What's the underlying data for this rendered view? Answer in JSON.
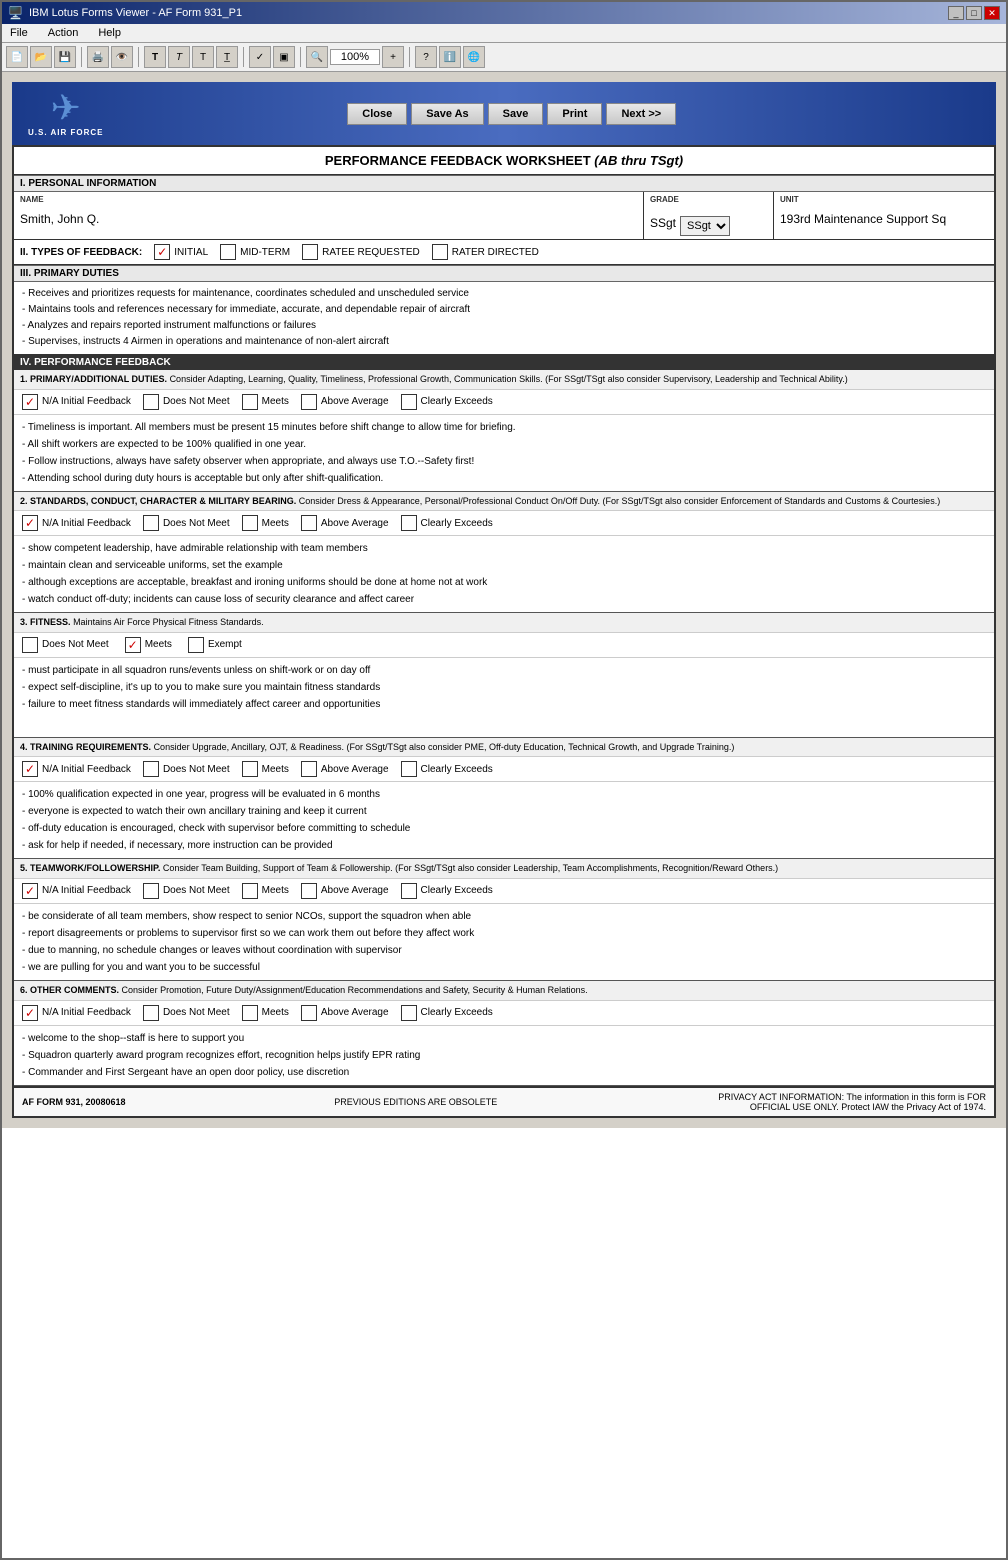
{
  "window": {
    "title": "IBM Lotus Forms Viewer - AF Form 931_P1",
    "titlebar_icon": "🪟"
  },
  "menu": {
    "items": [
      "File",
      "Action",
      "Help"
    ]
  },
  "toolbar": {
    "zoom": "100%"
  },
  "header": {
    "logo_text": "U.S. AIR FORCE",
    "buttons": [
      "Close",
      "Save As",
      "Save",
      "Print",
      "Next >>"
    ]
  },
  "form": {
    "title": "PERFORMANCE FEEDBACK WORKSHEET",
    "title_subtitle": "(AB thru TSgt)",
    "sections": {
      "personal_info_header": "I.  PERSONAL INFORMATION",
      "name_label": "NAME",
      "name_value": "Smith, John Q.",
      "grade_label": "GRADE",
      "grade_value": "SSgt",
      "unit_label": "UNIT",
      "unit_value": "193rd Maintenance Support Sq",
      "feedback_types_label": "II.  TYPES OF FEEDBACK:",
      "feedback_types": [
        {
          "label": "INITIAL",
          "checked": true
        },
        {
          "label": "MID-TERM",
          "checked": false
        },
        {
          "label": "RATEE REQUESTED",
          "checked": false
        },
        {
          "label": "RATER DIRECTED",
          "checked": false
        }
      ],
      "primary_duties_header": "III.  PRIMARY DUTIES",
      "primary_duties": [
        "- Receives and prioritizes requests for maintenance, coordinates scheduled and unscheduled service",
        "- Maintains tools and references necessary for immediate, accurate, and dependable repair of aircraft",
        "- Analyzes and repairs reported instrument malfunctions or failures",
        "- Supervises, instructs 4 Airmen in operations and maintenance of non-alert aircraft"
      ],
      "perf_feedback_header": "IV.  PERFORMANCE FEEDBACK",
      "perf_items": [
        {
          "number": "1.",
          "title": "PRIMARY/ADDITIONAL DUTIES.",
          "description": "Consider Adapting, Learning, Quality, Timeliness, Professional Growth, Communication Skills.  (For SSgt/TSgt also consider Supervisory, Leadership and Technical Ability.)",
          "ratings": [
            "N/A Initial Feedback",
            "Does Not Meet",
            "Meets",
            "Above Average",
            "Clearly Exceeds"
          ],
          "checked": "N/A Initial Feedback",
          "text": [
            "- Timeliness is important.  All members must be present 15 minutes before shift change to allow time for briefing.",
            "- All shift workers are expected to be 100% qualified in one year.",
            "- Follow instructions, always have safety observer when appropriate, and always use T.O.--Safety first!",
            "- Attending school during duty hours is acceptable but only after shift-qualification."
          ]
        },
        {
          "number": "2.",
          "title": "STANDARDS, CONDUCT, CHARACTER & MILITARY BEARING.",
          "description": "Consider Dress & Appearance, Personal/Professional Conduct On/Off Duty.  (For SSgt/TSgt also consider Enforcement of Standards and Customs & Courtesies.)",
          "ratings": [
            "N/A Initial Feedback",
            "Does Not Meet",
            "Meets",
            "Above Average",
            "Clearly Exceeds"
          ],
          "checked": "N/A Initial Feedback",
          "text": [
            "- show competent leadership, have admirable relationship with team members",
            "- maintain clean and serviceable uniforms, set the example",
            "- although exceptions are acceptable, breakfast and ironing uniforms should be done at home not at work",
            "- watch conduct off-duty; incidents can cause loss of security clearance and affect career"
          ]
        },
        {
          "number": "3.",
          "title": "FITNESS.",
          "description": "Maintains Air Force Physical Fitness Standards.",
          "ratings": [
            "Does Not Meet",
            "Meets",
            "Exempt"
          ],
          "checked": "Meets",
          "fitness": true,
          "text": [
            "- must participate in all squadron runs/events unless on shift-work or on day off",
            "- expect self-discipline, it's up to you to make sure you maintain fitness standards",
            "- failure to meet fitness standards will immediately affect career and opportunities"
          ]
        },
        {
          "number": "4.",
          "title": "TRAINING REQUIREMENTS.",
          "description": "Consider Upgrade, Ancillary, OJT, & Readiness.  (For SSgt/TSgt also consider PME, Off-duty Education, Technical Growth, and Upgrade Training.)",
          "ratings": [
            "N/A Initial Feedback",
            "Does Not Meet",
            "Meets",
            "Above Average",
            "Clearly Exceeds"
          ],
          "checked": "N/A Initial Feedback",
          "text": [
            "- 100% qualification expected in one year, progress will be evaluated in 6 months",
            "- everyone is expected to watch their own ancillary training and keep it current",
            "- off-duty education is encouraged, check with supervisor before committing to schedule",
            "- ask for help if needed, if necessary, more instruction can be provided"
          ]
        },
        {
          "number": "5.",
          "title": "TEAMWORK/FOLLOWERSHIP.",
          "description": "Consider Team Building, Support of Team & Followership.  (For SSgt/TSgt also consider Leadership, Team Accomplishments, Recognition/Reward Others.)",
          "ratings": [
            "N/A Initial Feedback",
            "Does Not Meet",
            "Meets",
            "Above Average",
            "Clearly Exceeds"
          ],
          "checked": "N/A Initial Feedback",
          "text": [
            "- be considerate of all team members, show respect to senior NCOs, support the squadron when able",
            "- report disagreements or problems to supervisor first so we can work them out before they affect work",
            "- due to manning, no schedule changes or leaves without coordination with supervisor",
            "- we are pulling for you and want you to be successful"
          ]
        },
        {
          "number": "6.",
          "title": "OTHER COMMENTS.",
          "description": "Consider Promotion, Future Duty/Assignment/Education Recommendations and Safety, Security & Human Relations.",
          "ratings": [
            "N/A Initial Feedback",
            "Does Not Meet",
            "Meets",
            "Above Average",
            "Clearly Exceeds"
          ],
          "checked": "N/A Initial Feedback",
          "text": [
            "- welcome to the shop--staff is here to support you",
            "- Squadron quarterly award program recognizes effort, recognition helps justify EPR rating",
            "- Commander and First Sergeant have an open door policy, use discretion"
          ]
        }
      ],
      "footer_left": "AF FORM 931, 20080618",
      "footer_center": "PREVIOUS EDITIONS ARE OBSOLETE",
      "footer_right": "PRIVACY ACT INFORMATION: The information in this form is FOR OFFICIAL USE ONLY.  Protect IAW the Privacy Act of 1974."
    }
  }
}
